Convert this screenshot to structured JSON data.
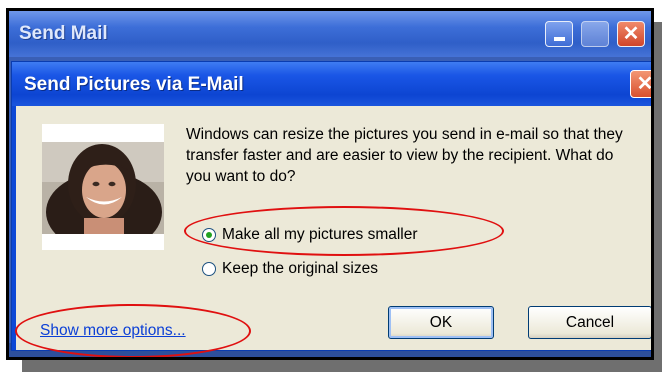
{
  "background_window": {
    "title": "Send Mail"
  },
  "dialog": {
    "title": "Send Pictures via E-Mail",
    "message": "Windows can resize the pictures you send in e-mail so that they transfer faster and are easier to view by the recipient.  What do you want to do?",
    "options": [
      {
        "label": "Make all my pictures smaller",
        "selected": true
      },
      {
        "label": "Keep the original sizes",
        "selected": false
      }
    ],
    "more_options_link": "Show more options...",
    "ok_label": "OK",
    "cancel_label": "Cancel"
  },
  "annotations": {
    "highlight_color": "#e01010",
    "highlighted": [
      "Make all my pictures smaller",
      "Show more options..."
    ]
  },
  "colors": {
    "titlebar_blue": "#0d48d6",
    "dialog_face": "#ece9d8",
    "link": "#0b3fd6"
  }
}
